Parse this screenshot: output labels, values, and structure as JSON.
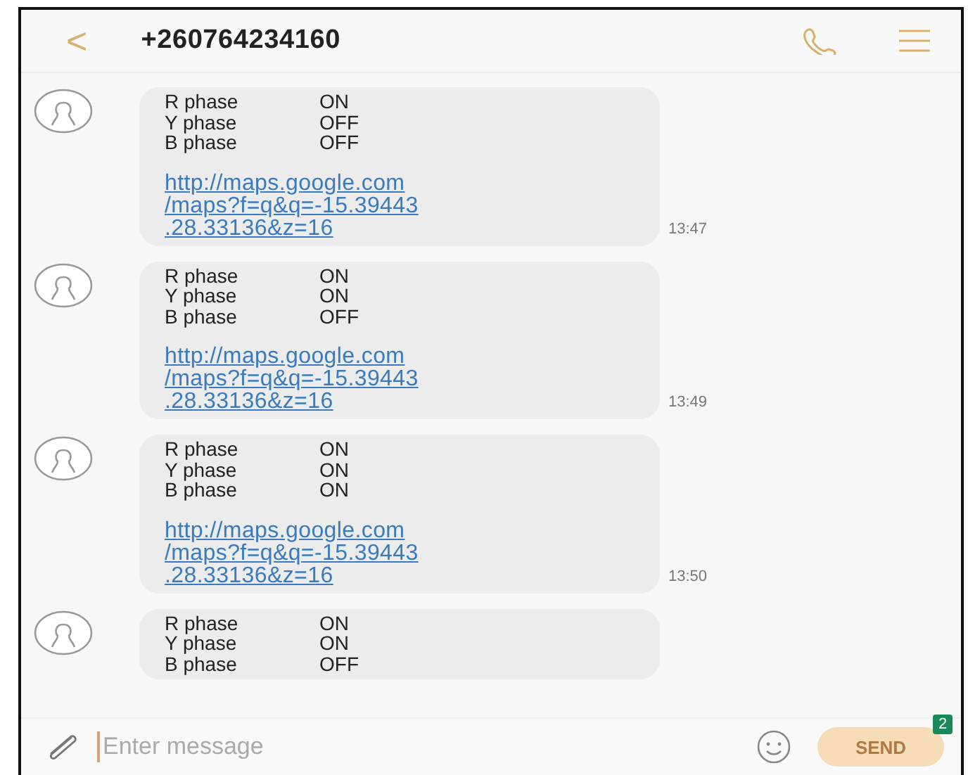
{
  "header": {
    "back": "<",
    "title": "+260764234160"
  },
  "messages": [
    {
      "rows": [
        {
          "label": "R phase",
          "value": "ON"
        },
        {
          "label": "Y phase",
          "value": "OFF"
        },
        {
          "label": "B phase",
          "value": "OFF"
        }
      ],
      "link_lines": [
        "http://maps.google.com",
        "/maps?f=q&q=-15.39443",
        ".28.33136&z=16"
      ],
      "time": "13:47"
    },
    {
      "rows": [
        {
          "label": "R phase",
          "value": "ON"
        },
        {
          "label": "Y phase",
          "value": "ON"
        },
        {
          "label": "B phase",
          "value": "OFF"
        }
      ],
      "link_lines": [
        "http://maps.google.com",
        "/maps?f=q&q=-15.39443",
        ".28.33136&z=16"
      ],
      "time": "13:49"
    },
    {
      "rows": [
        {
          "label": "R phase",
          "value": "ON"
        },
        {
          "label": "Y phase",
          "value": "ON"
        },
        {
          "label": "B phase",
          "value": "ON"
        }
      ],
      "link_lines": [
        "http://maps.google.com",
        "/maps?f=q&q=-15.39443",
        ".28.33136&z=16"
      ],
      "time": "13:50"
    },
    {
      "rows": [
        {
          "label": "R phase",
          "value": "ON"
        },
        {
          "label": "Y phase",
          "value": "ON"
        },
        {
          "label": "B phase",
          "value": "OFF"
        }
      ]
    }
  ],
  "composer": {
    "placeholder": "Enter message",
    "send": "SEND",
    "badge": "2",
    "disabled": true
  }
}
